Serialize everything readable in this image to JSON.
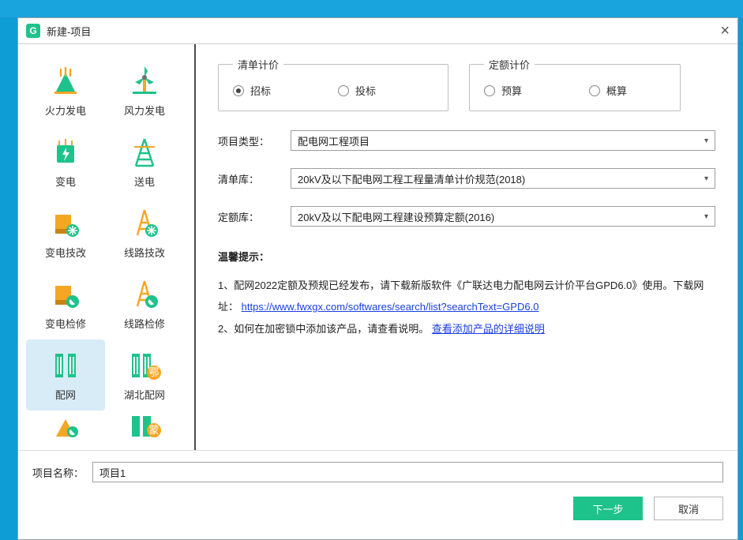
{
  "titlebar": {
    "logo_letter": "G",
    "title": "新建-项目",
    "close": "×"
  },
  "catalog": {
    "items": [
      {
        "key": "fire",
        "label": "火力发电"
      },
      {
        "key": "wind",
        "label": "风力发电"
      },
      {
        "key": "substation",
        "label": "变电"
      },
      {
        "key": "transmit",
        "label": "送电"
      },
      {
        "key": "sub-mod",
        "label": "变电技改"
      },
      {
        "key": "line-mod",
        "label": "线路技改"
      },
      {
        "key": "sub-maint",
        "label": "变电检修"
      },
      {
        "key": "line-maint",
        "label": "线路检修"
      },
      {
        "key": "distnet",
        "label": "配网",
        "selected": true
      },
      {
        "key": "hubei",
        "label": "湖北配网",
        "badge": "鄂"
      },
      {
        "key": "extra1",
        "label": ""
      },
      {
        "key": "extra2",
        "label": "",
        "badge": "蒙"
      }
    ]
  },
  "groups": {
    "list": {
      "legend": "清单计价",
      "opts": {
        "bid_call": "招标",
        "bid": "投标"
      },
      "selected": "bid_call"
    },
    "quota": {
      "legend": "定额计价",
      "opts": {
        "budget": "预算",
        "estimate": "概算"
      },
      "selected": ""
    }
  },
  "form": {
    "project_type": {
      "label": "项目类型：",
      "value": "配电网工程项目"
    },
    "list_db": {
      "label": "清单库：",
      "value": "20kV及以下配电网工程工程量清单计价规范(2018)"
    },
    "quota_db": {
      "label": "定额库：",
      "value": "20kV及以下配电网工程建设预算定额(2016)"
    }
  },
  "tips": {
    "head": "温馨提示：",
    "line1_pre": "1、配网2022定额及预规已经发布，请下载新版软件《广联达电力配电网云计价平台GPD6.0》使用。下载网址：",
    "line1_link": "https://www.fwxgx.com/softwares/search/list?searchText=GPD6.0",
    "line2_pre": "2、如何在加密锁中添加该产品，请查看说明。",
    "line2_link": "查看添加产品的详细说明"
  },
  "footer": {
    "name_label": "项目名称：",
    "name_value": "项目1",
    "next": "下一步",
    "cancel": "取消"
  },
  "colors": {
    "accent": "#1ec28b",
    "gold": "#f5a623",
    "steel": "#707070"
  }
}
